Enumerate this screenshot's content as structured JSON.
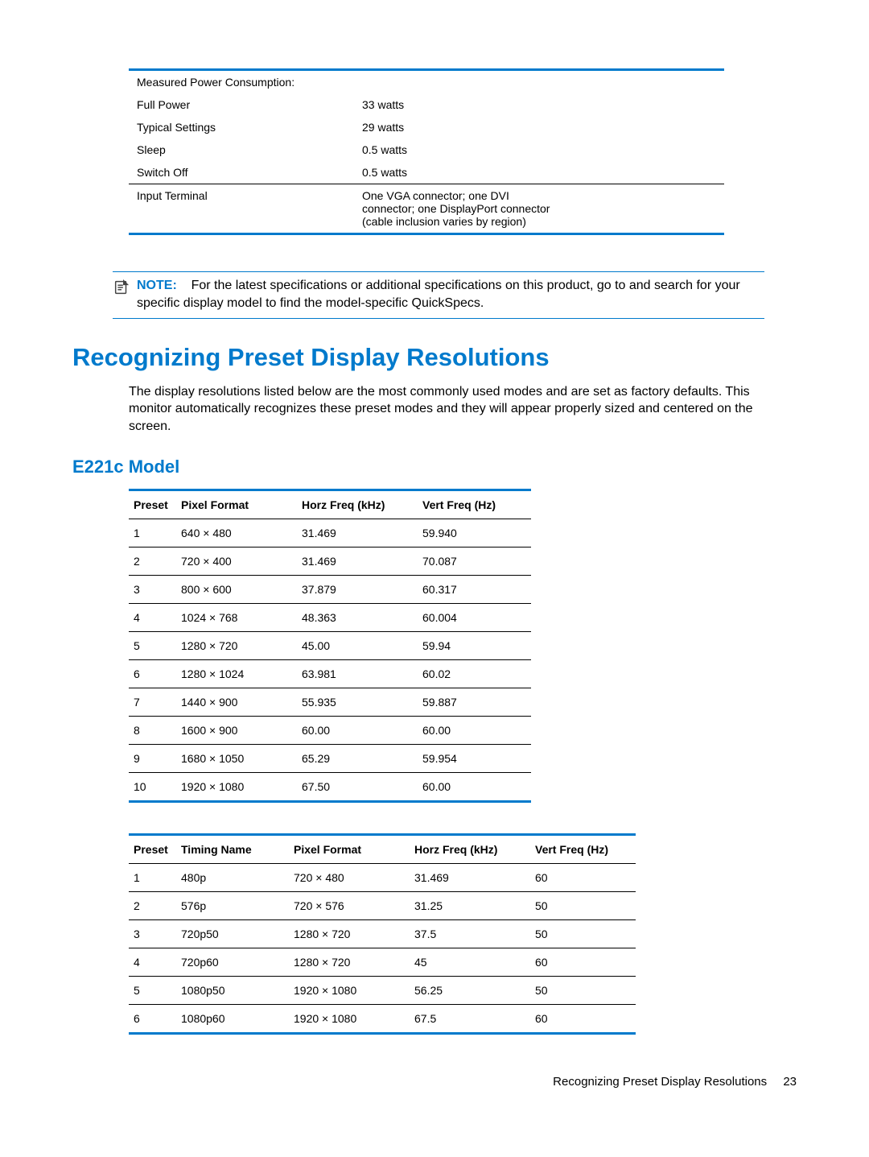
{
  "spec_table": {
    "header_label": "Measured Power Consumption:",
    "rows": [
      {
        "label": "Full Power",
        "value": "33 watts"
      },
      {
        "label": "Typical Settings",
        "value": "29 watts"
      },
      {
        "label": "Sleep",
        "value": "0.5 watts"
      },
      {
        "label": "Switch Off",
        "value": "0.5 watts"
      }
    ],
    "input_terminal_label": "Input Terminal",
    "input_terminal_value": "One VGA connector; one DVI connector; one DisplayPort connector (cable inclusion varies by region)"
  },
  "note": {
    "label": "NOTE:",
    "text": "For the latest specifications or additional specifications on this product, go to and search for your specific display model to find the model-specific QuickSpecs."
  },
  "h1": "Recognizing Preset Display Resolutions",
  "intro": "The display resolutions listed below are the most commonly used modes and are set as factory defaults. This monitor automatically recognizes these preset modes and they will appear properly sized and centered on the screen.",
  "h2": "E221c Model",
  "table1": {
    "headers": {
      "c1": "Preset",
      "c2": "Pixel Format",
      "c3": "Horz Freq (kHz)",
      "c4": "Vert Freq (Hz)"
    },
    "rows": [
      {
        "c1": "1",
        "c2": "640 × 480",
        "c3": "31.469",
        "c4": "59.940"
      },
      {
        "c1": "2",
        "c2": "720 × 400",
        "c3": "31.469",
        "c4": "70.087"
      },
      {
        "c1": "3",
        "c2": "800 × 600",
        "c3": "37.879",
        "c4": "60.317"
      },
      {
        "c1": "4",
        "c2": "1024 × 768",
        "c3": "48.363",
        "c4": "60.004"
      },
      {
        "c1": "5",
        "c2": "1280 × 720",
        "c3": "45.00",
        "c4": "59.94"
      },
      {
        "c1": "6",
        "c2": "1280 × 1024",
        "c3": "63.981",
        "c4": "60.02"
      },
      {
        "c1": "7",
        "c2": "1440 × 900",
        "c3": "55.935",
        "c4": "59.887"
      },
      {
        "c1": "8",
        "c2": "1600 × 900",
        "c3": "60.00",
        "c4": "60.00"
      },
      {
        "c1": "9",
        "c2": "1680 × 1050",
        "c3": "65.29",
        "c4": "59.954"
      },
      {
        "c1": "10",
        "c2": "1920 × 1080",
        "c3": "67.50",
        "c4": "60.00"
      }
    ]
  },
  "table2": {
    "headers": {
      "c1": "Preset",
      "c2": "Timing Name",
      "c3": "Pixel Format",
      "c4": "Horz Freq (kHz)",
      "c5": "Vert Freq (Hz)"
    },
    "rows": [
      {
        "c1": "1",
        "c2": "480p",
        "c3": "720 × 480",
        "c4": "31.469",
        "c5": "60"
      },
      {
        "c1": "2",
        "c2": "576p",
        "c3": "720 × 576",
        "c4": "31.25",
        "c5": "50"
      },
      {
        "c1": "3",
        "c2": "720p50",
        "c3": "1280 × 720",
        "c4": "37.5",
        "c5": "50"
      },
      {
        "c1": "4",
        "c2": "720p60",
        "c3": "1280 × 720",
        "c4": "45",
        "c5": "60"
      },
      {
        "c1": "5",
        "c2": "1080p50",
        "c3": "1920 × 1080",
        "c4": "56.25",
        "c5": "50"
      },
      {
        "c1": "6",
        "c2": "1080p60",
        "c3": "1920 × 1080",
        "c4": "67.5",
        "c5": "60"
      }
    ]
  },
  "footer": {
    "title": "Recognizing Preset Display Resolutions",
    "page": "23"
  }
}
